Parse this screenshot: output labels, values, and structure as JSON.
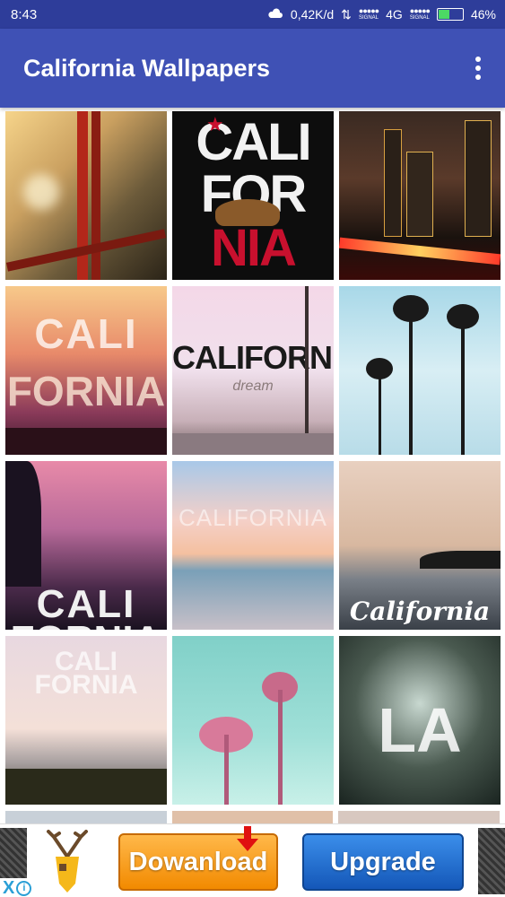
{
  "status_bar": {
    "time": "8:43",
    "speed": "0,42K/d",
    "signal_label": "SIGNAL",
    "network": "4G",
    "battery": "46%",
    "battery_level": 0.46
  },
  "app_bar": {
    "title": "California Wallpapers",
    "overflow_icon": "more-vert-icon"
  },
  "wallpapers": [
    {
      "name": "golden-gate-bridge",
      "overlay_text": ""
    },
    {
      "name": "cali-for-nia-flag",
      "overlay_text": "CALI FOR NIA"
    },
    {
      "name": "los-angeles-night-skyline",
      "overlay_text": ""
    },
    {
      "name": "cali-fornia-sunset-palms",
      "overlay_text": "CALI FORNIA"
    },
    {
      "name": "california-dream-street",
      "overlay_text": "CALIFORNIA",
      "sub_text": "dream"
    },
    {
      "name": "palm-trees-blue-sky",
      "overlay_text": ""
    },
    {
      "name": "cali-fornia-purple-palms",
      "overlay_text": "CALI FORNIA"
    },
    {
      "name": "california-beach-pastel",
      "overlay_text": "CALIFORNIA"
    },
    {
      "name": "california-coast-script",
      "overlay_text": "California"
    },
    {
      "name": "cali-fornia-beach-palms",
      "overlay_text": "CALI FORNIA"
    },
    {
      "name": "pink-palms-teal-sky",
      "overlay_text": ""
    },
    {
      "name": "la-palm-leaves",
      "overlay_text": "LA"
    }
  ],
  "ad": {
    "download_label": "Dowanload",
    "upgrade_label": "Upgrade",
    "close_label": "X",
    "info_label": "i"
  }
}
